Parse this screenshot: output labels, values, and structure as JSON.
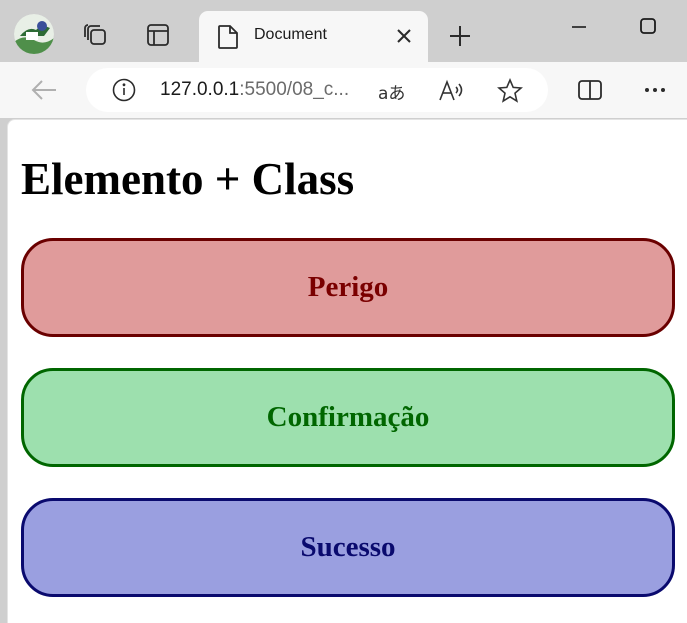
{
  "browser": {
    "tab": {
      "title": "Document",
      "icon": "document-icon"
    },
    "address": {
      "host": "127.0.0.1",
      "rest": ":5500/08_c...",
      "read_label": "aあ"
    }
  },
  "page": {
    "heading": "Elemento + Class",
    "boxes": [
      {
        "label": "Perigo",
        "bg": "#e09b9b",
        "border": "#6a0000",
        "text": "#7a0000"
      },
      {
        "label": "Confirmação",
        "bg": "#9de0ae",
        "border": "#006600",
        "text": "#006600"
      },
      {
        "label": "Sucesso",
        "bg": "#9a9fe0",
        "border": "#0a0a6e",
        "text": "#0a0a6e"
      }
    ]
  }
}
